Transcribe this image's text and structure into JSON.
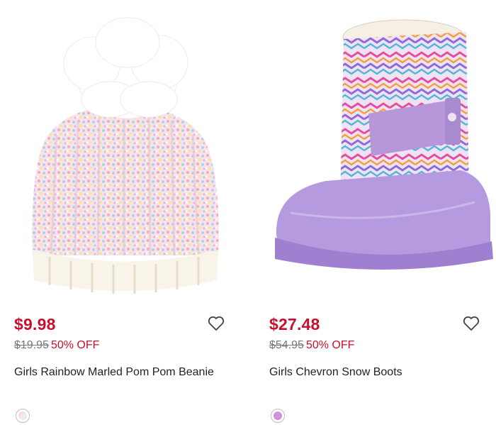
{
  "products": [
    {
      "name": "Girls Rainbow Marled Pom Pom Beanie",
      "price": "$9.98",
      "original_price": "$19.95",
      "discount": "50% OFF",
      "image_icon": "beanie-image",
      "swatch_color": "#f2d6df"
    },
    {
      "name": "Girls Chevron Snow Boots",
      "price": "$27.48",
      "original_price": "$54.95",
      "discount": "50% OFF",
      "image_icon": "snow-boot-image",
      "swatch_color": "#cf93d9"
    }
  ],
  "colors": {
    "sale_red": "#c8102e",
    "strike_gray": "#777777"
  }
}
